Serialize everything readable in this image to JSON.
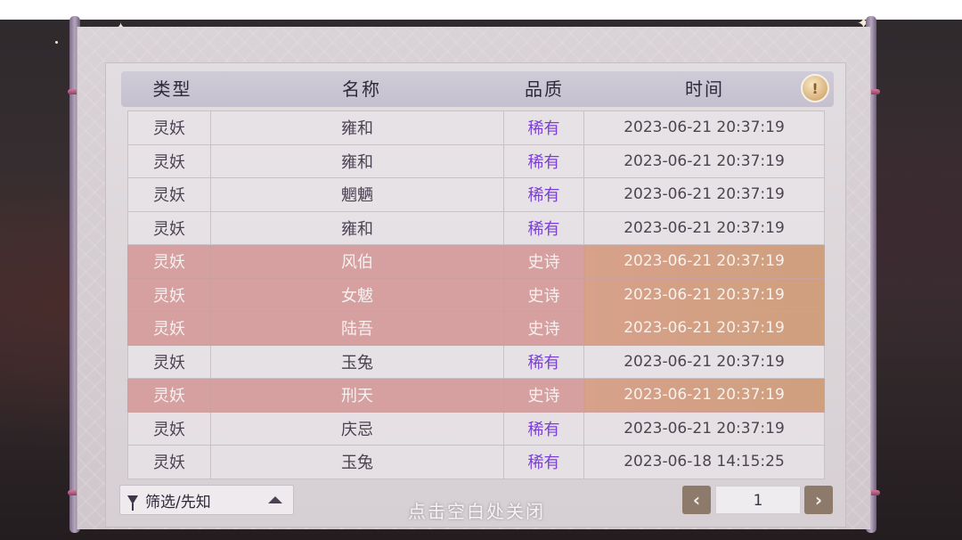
{
  "header": {
    "type_label": "类型",
    "name_label": "名称",
    "quality_label": "品质",
    "time_label": "时间",
    "info_icon": "lightbulb-icon"
  },
  "rows": [
    {
      "type": "灵妖",
      "name": "雍和",
      "quality": "稀有",
      "time": "2023-06-21  20:37:19",
      "tier": "rare"
    },
    {
      "type": "灵妖",
      "name": "雍和",
      "quality": "稀有",
      "time": "2023-06-21  20:37:19",
      "tier": "rare"
    },
    {
      "type": "灵妖",
      "name": "魍魉",
      "quality": "稀有",
      "time": "2023-06-21  20:37:19",
      "tier": "rare"
    },
    {
      "type": "灵妖",
      "name": "雍和",
      "quality": "稀有",
      "time": "2023-06-21  20:37:19",
      "tier": "rare"
    },
    {
      "type": "灵妖",
      "name": "风伯",
      "quality": "史诗",
      "time": "2023-06-21  20:37:19",
      "tier": "epic"
    },
    {
      "type": "灵妖",
      "name": "女魃",
      "quality": "史诗",
      "time": "2023-06-21  20:37:19",
      "tier": "epic"
    },
    {
      "type": "灵妖",
      "name": "陆吾",
      "quality": "史诗",
      "time": "2023-06-21  20:37:19",
      "tier": "epic"
    },
    {
      "type": "灵妖",
      "name": "玉兔",
      "quality": "稀有",
      "time": "2023-06-21  20:37:19",
      "tier": "rare"
    },
    {
      "type": "灵妖",
      "name": "刑天",
      "quality": "史诗",
      "time": "2023-06-21  20:37:19",
      "tier": "epic"
    },
    {
      "type": "灵妖",
      "name": "庆忌",
      "quality": "稀有",
      "time": "2023-06-21  20:37:19",
      "tier": "rare"
    },
    {
      "type": "灵妖",
      "name": "玉兔",
      "quality": "稀有",
      "time": "2023-06-18  14:15:25",
      "tier": "rare"
    }
  ],
  "footer": {
    "filter_label": "筛选/先知",
    "close_hint": "点击空白处关闭",
    "page_number": "1",
    "prev_label": "‹",
    "next_label": "›"
  },
  "colors": {
    "rare_text": "#7b3fd6",
    "epic_row": "#d6a0a0"
  }
}
